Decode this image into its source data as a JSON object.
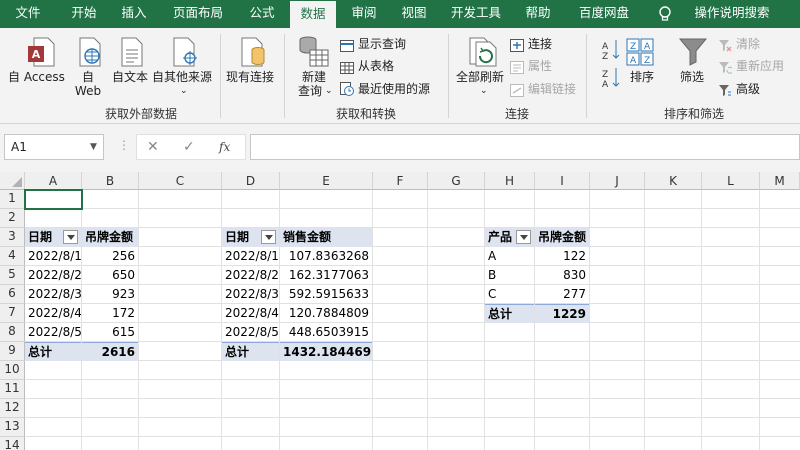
{
  "menu": {
    "tabs": [
      "文件",
      "开始",
      "插入",
      "页面布局",
      "公式",
      "数据",
      "审阅",
      "视图",
      "开发工具",
      "帮助",
      "百度网盘"
    ],
    "active": "数据",
    "tell_me": "操作说明搜索"
  },
  "ribbon": {
    "get_external": {
      "access": "自 Access",
      "web_line1": "自",
      "web_line2": "Web",
      "text": "自文本",
      "other": "自其他来源",
      "existing": "现有连接",
      "label": "获取外部数据"
    },
    "transform": {
      "new_query_line1": "新建",
      "new_query_line2": "查询",
      "show_queries": "显示查询",
      "from_table": "从表格",
      "recent_sources": "最近使用的源",
      "label": "获取和转换"
    },
    "connections": {
      "refresh_all": "全部刷新",
      "connections": "连接",
      "properties": "属性",
      "edit_links": "编辑链接",
      "label": "连接"
    },
    "sort_filter": {
      "sort": "排序",
      "filter": "筛选",
      "clear": "清除",
      "reapply": "重新应用",
      "advanced": "高级",
      "label": "排序和筛选"
    }
  },
  "formula_bar": {
    "name_box": "A1",
    "fx": "fx",
    "value": ""
  },
  "columns": [
    "A",
    "B",
    "C",
    "D",
    "E",
    "F",
    "G",
    "H",
    "I",
    "J",
    "K",
    "L",
    "M"
  ],
  "rows": [
    "1",
    "2",
    "3",
    "4",
    "5",
    "6",
    "7",
    "8",
    "9",
    "10",
    "11",
    "12",
    "13",
    "14"
  ],
  "table1": {
    "headers": [
      "日期",
      "吊牌金额"
    ],
    "rows": [
      [
        "2022/8/1",
        "256"
      ],
      [
        "2022/8/2",
        "650"
      ],
      [
        "2022/8/3",
        "923"
      ],
      [
        "2022/8/4",
        "172"
      ],
      [
        "2022/8/5",
        "615"
      ]
    ],
    "total_label": "总计",
    "total": "2616"
  },
  "table2": {
    "headers": [
      "日期",
      "销售金额"
    ],
    "rows": [
      [
        "2022/8/1",
        "107.8363268"
      ],
      [
        "2022/8/2",
        "162.3177063"
      ],
      [
        "2022/8/3",
        "592.5915633"
      ],
      [
        "2022/8/4",
        "120.7884809"
      ],
      [
        "2022/8/5",
        "448.6503915"
      ]
    ],
    "total_label": "总计",
    "total": "1432.184469"
  },
  "table3": {
    "headers": [
      "产品",
      "吊牌金额"
    ],
    "rows": [
      [
        "A",
        "122"
      ],
      [
        "B",
        "830"
      ],
      [
        "C",
        "277"
      ]
    ],
    "total_label": "总计",
    "total": "1229"
  }
}
